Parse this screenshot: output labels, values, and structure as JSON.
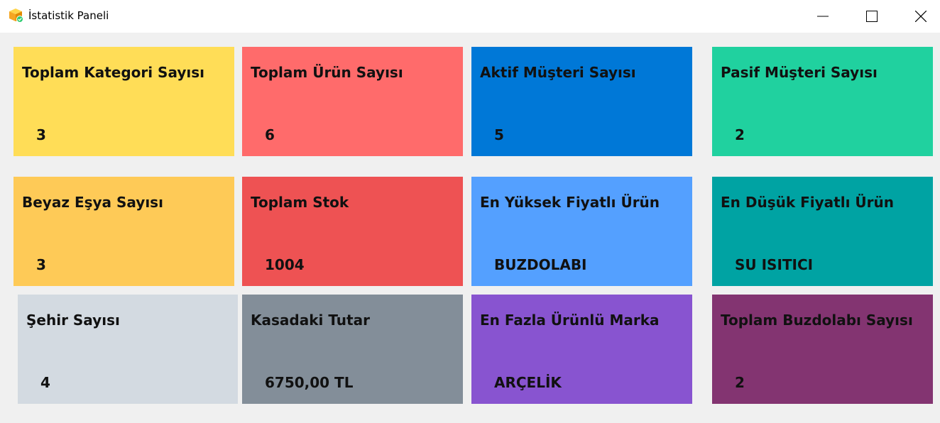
{
  "window": {
    "title": "İstatistik Paneli"
  },
  "cards": [
    {
      "label": "Toplam Kategori Sayısı",
      "value": "3",
      "color": "#ffdd57"
    },
    {
      "label": "Toplam Ürün Sayısı",
      "value": "6",
      "color": "#ff6b6b"
    },
    {
      "label": "Aktif Müşteri Sayısı",
      "value": "5",
      "color": "#0078d7"
    },
    {
      "label": "Pasif Müşteri Sayısı",
      "value": "2",
      "color": "#20d19f"
    },
    {
      "label": "Beyaz Eşya Sayısı",
      "value": "3",
      "color": "#feca57"
    },
    {
      "label": "Toplam Stok",
      "value": "1004",
      "color": "#ee5253"
    },
    {
      "label": "En Yüksek Fiyatlı Ürün",
      "value": "BUZDOLABI",
      "color": "#54a0ff"
    },
    {
      "label": "En Düşük Fiyatlı Ürün",
      "value": "SU ISITICI",
      "color": "#00a3a3"
    },
    {
      "label": "Şehir Sayısı",
      "value": "4",
      "color": "#d3dae1"
    },
    {
      "label": "Kasadaki Tutar",
      "value": "6750,00 TL",
      "color": "#838e99"
    },
    {
      "label": "En Fazla Ürünlü Marka",
      "value": "ARÇELİK",
      "color": "#8854d0"
    },
    {
      "label": "Toplam Buzdolabı Sayısı",
      "value": "2",
      "color": "#833471"
    }
  ],
  "icons": {
    "app": "cube-icon",
    "minimize": "minimize-icon",
    "maximize": "maximize-icon",
    "close": "close-icon"
  }
}
